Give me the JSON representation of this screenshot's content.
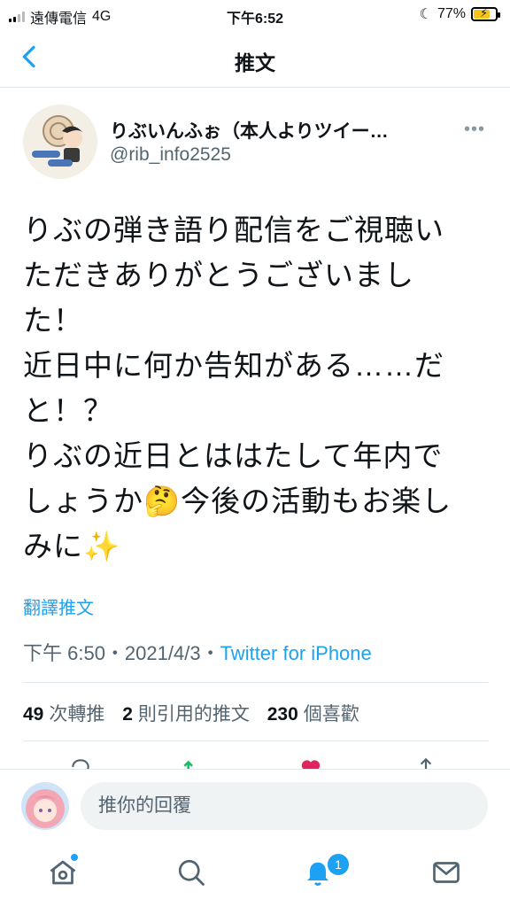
{
  "status_bar": {
    "carrier": "遠傳電信",
    "network": "4G",
    "time": "下午6:52",
    "battery": "77%",
    "battery_level": 0.77
  },
  "header": {
    "title": "推文"
  },
  "tweet": {
    "author_name": "りぶいんふぉ（本人よりツイー…",
    "author_handle": "@rib_info2525",
    "text_lines": [
      "りぶの弾き語り配信をご視聴い",
      "ただきありがとうございまし",
      "た！",
      "近日中に何か告知がある……だ",
      "と！？",
      "りぶの近日とははたして年内で",
      "しょうか🤔今後の活動もお楽し",
      "みに✨"
    ],
    "translate_label": "翻譯推文",
    "timestamp": "下午 6:50・2021/4/3・",
    "source": "Twitter for iPhone",
    "stats": {
      "retweets_count": "49",
      "retweets_label": "次轉推",
      "quotes_count": "2",
      "quotes_label": "則引用的推文",
      "likes_count": "230",
      "likes_label": "個喜歡"
    }
  },
  "reply": {
    "placeholder": "推你的回覆"
  },
  "tabbar": {
    "items": [
      "home-icon",
      "search-icon",
      "notifications-icon",
      "messages-icon"
    ],
    "notifications_badge": "1"
  },
  "colors": {
    "accent": "#1da1f2",
    "text": "#0f1419",
    "secondary": "#536471",
    "like": "#e0245e",
    "retweet": "#17bf63"
  }
}
